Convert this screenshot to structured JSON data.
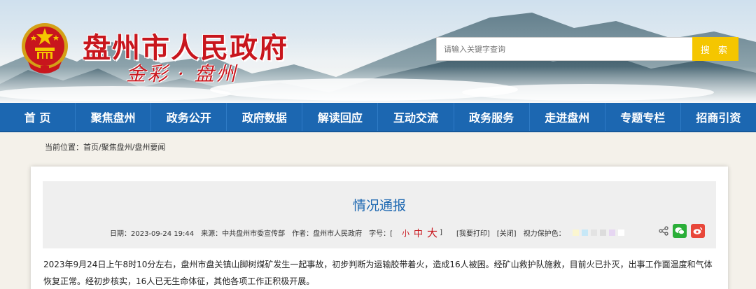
{
  "header": {
    "site_title": "盘州市人民政府",
    "slogan": "金彩 · 盘州",
    "search_placeholder": "请输入关键字查询",
    "search_button": "搜 索"
  },
  "nav": {
    "items": [
      "首 页",
      "聚焦盘州",
      "政务公开",
      "政府数据",
      "解读回应",
      "互动交流",
      "政务服务",
      "走进盘州",
      "专题专栏",
      "招商引资"
    ]
  },
  "breadcrumb": "当前位置：首页/聚焦盘州/盘州要闻",
  "article": {
    "title": "情况通报",
    "date": "日期：2023-09-24 19:44",
    "source": "来源：中共盘州市委宣传部",
    "author": "作者：盘州市人民政府",
    "font_size_label": "字号：[",
    "font_small": "小",
    "font_mid": "中",
    "font_big": "大",
    "font_close": "]",
    "print": "[我要打印]",
    "close": "[关闭]",
    "vision_label": "视力保护色：",
    "body": "2023年9月24日上午8时10分左右，盘州市盘关镇山脚树煤矿发生一起事故，初步判断为运输胶带着火，造成16人被困。经矿山救护队施救，目前火已扑灭，出事工作面温度和气体恢复正常。经初步核实，16人已无生命体征，其他各项工作正积极开展。"
  },
  "colors": {
    "brand_red": "#c8161d",
    "nav_blue": "#1c67b1",
    "search_yellow": "#f5c600",
    "vision_swatches": [
      "#fbf6d0",
      "#c7e8f7",
      "#e3e3e3",
      "#dcdcdc",
      "#e6d6f2",
      "#ffffff"
    ]
  },
  "icons": [
    "national-emblem",
    "share-icon",
    "wechat-icon",
    "weibo-icon"
  ]
}
